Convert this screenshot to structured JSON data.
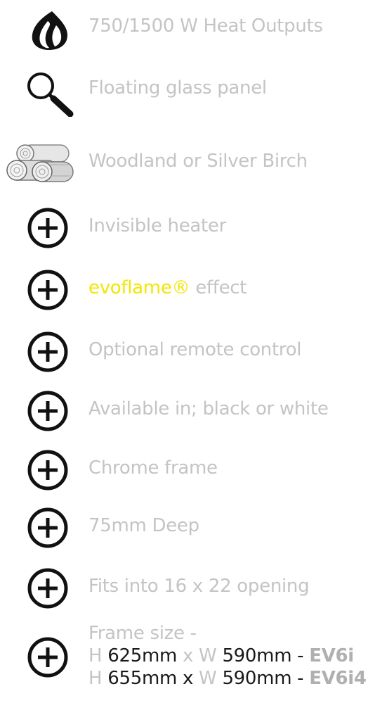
{
  "features": [
    {
      "icon": "flame-icon",
      "label": "750/1500 W Heat Outputs"
    },
    {
      "icon": "magnifier-icon",
      "label": "Floating glass panel"
    },
    {
      "icon": "logs-icon",
      "label": "Woodland or Silver Birch"
    },
    {
      "icon": "plus-circle-icon",
      "label": "Invisible heater"
    },
    {
      "icon": "plus-circle-icon",
      "label_highlight": "evoflame®",
      "label_rest": " effect"
    },
    {
      "icon": "plus-circle-icon",
      "label": "Optional remote control"
    },
    {
      "icon": "plus-circle-icon",
      "label": "Available in; black or white"
    },
    {
      "icon": "plus-circle-icon",
      "label": "Chrome frame"
    },
    {
      "icon": "plus-circle-icon",
      "label": "75mm Deep"
    },
    {
      "icon": "plus-circle-icon",
      "label": "Fits into 16 x 22 opening"
    }
  ],
  "frame_size": {
    "icon": "plus-circle-icon",
    "heading": "Frame size -",
    "specs": [
      {
        "h_label": "H",
        "h_value": "625mm",
        "x": "x",
        "w_label": "W",
        "w_value": "590mm",
        "sep": " - ",
        "model": "EV6i"
      },
      {
        "h_label": "H",
        "h_value": "655mm",
        "x": "x",
        "w_label": "W",
        "w_value": "590mm",
        "sep": " - ",
        "model": "EV6i4"
      }
    ]
  },
  "colors": {
    "label": "#c4c4c4",
    "accent": "#f2e600",
    "dark": "#1a1a1a"
  }
}
